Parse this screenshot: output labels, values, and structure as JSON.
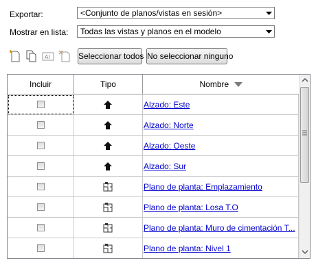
{
  "export": {
    "label": "Exportar:",
    "value": "<Conjunto de planos/vistas en sesión>"
  },
  "show_list": {
    "label": "Mostrar en lista:",
    "value": "Todas las vistas y planos en el modelo"
  },
  "toolbar": {
    "icons": [
      "new-set-icon",
      "duplicate-icon",
      "rename-icon",
      "delete-icon"
    ],
    "select_all_label": "Seleccionar todos",
    "select_none_label": "No seleccionar ninguno"
  },
  "table": {
    "headers": {
      "include": "Incluir",
      "type": "Tipo",
      "name": "Nombre"
    },
    "rows": [
      {
        "checked": false,
        "type": "elevation",
        "name": "Alzado: Este"
      },
      {
        "checked": false,
        "type": "elevation",
        "name": "Alzado: Norte"
      },
      {
        "checked": false,
        "type": "elevation",
        "name": "Alzado: Oeste"
      },
      {
        "checked": false,
        "type": "elevation",
        "name": "Alzado: Sur"
      },
      {
        "checked": false,
        "type": "floor-plan",
        "name": "Plano de planta: Emplazamiento"
      },
      {
        "checked": false,
        "type": "floor-plan",
        "name": "Plano de planta: Losa T.O"
      },
      {
        "checked": false,
        "type": "floor-plan",
        "name": "Plano de planta: Muro de cimentación T..."
      },
      {
        "checked": false,
        "type": "floor-plan",
        "name": "Plano de planta: Nivel 1"
      }
    ]
  }
}
